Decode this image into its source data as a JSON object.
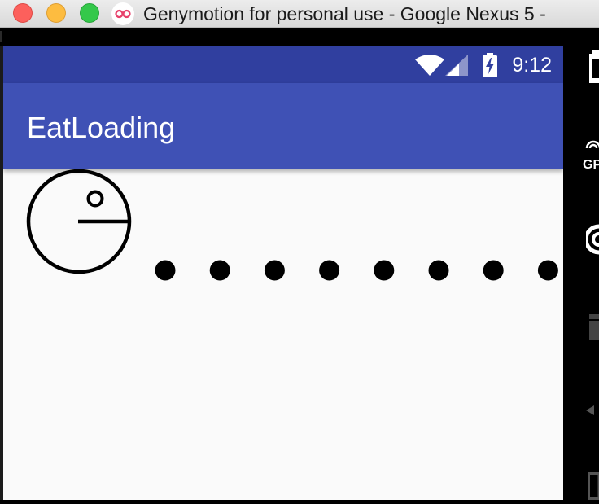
{
  "window": {
    "title": "Genymotion for personal use - Google Nexus 5 -",
    "app_icon": "genymotion-logo-icon"
  },
  "status_bar": {
    "time": "9:12",
    "icons": [
      "wifi-icon",
      "signal-icon",
      "battery-charging-icon"
    ]
  },
  "app_bar": {
    "title": "EatLoading"
  },
  "loader": {
    "pacman_icon": "pacman-icon",
    "dot_count": 8
  },
  "side_panel": {
    "items": [
      "battery-widget-icon",
      "gps-widget-icon",
      "camera-widget-icon",
      "video-widget-icon",
      "back-nav-icon",
      "recent-apps-icon"
    ],
    "gps_label": "GP"
  },
  "colors": {
    "status_bar": "#303f9f",
    "app_bar": "#3f51b5",
    "background": "#fafafa"
  }
}
